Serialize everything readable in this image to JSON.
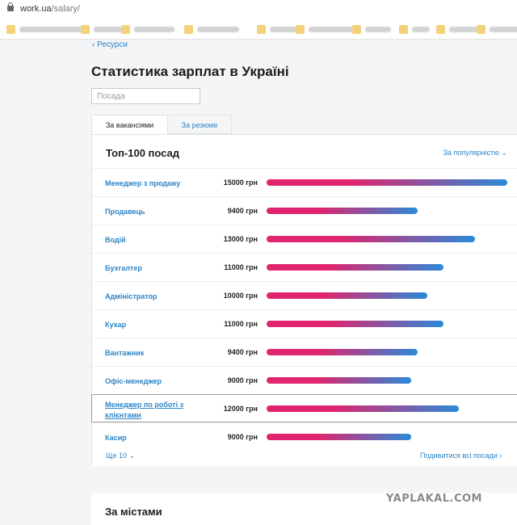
{
  "browser": {
    "url_host": "work.ua",
    "url_path": "/salary/"
  },
  "nav": {
    "back_label": "Ресурси"
  },
  "page": {
    "title": "Статистика зарплат в Україні"
  },
  "search": {
    "placeholder": "Посада",
    "value": ""
  },
  "tabs": [
    {
      "label": "За вакансіями",
      "active": true
    },
    {
      "label": "За резюме",
      "active": false
    }
  ],
  "top": {
    "title": "Топ-100 посад",
    "sort_label": "За популярністю",
    "more_label": "Ще 10",
    "view_all_label": "Подивитися всі посади"
  },
  "chart_data": {
    "type": "bar",
    "orientation": "horizontal",
    "unit": "грн",
    "xlim": [
      0,
      15000
    ],
    "categories": [
      "Менеджер з продажу",
      "Продавець",
      "Водій",
      "Бухгалтер",
      "Адміністратор",
      "Кухар",
      "Вантажник",
      "Офіс-менеджер",
      "Менеджер по роботі з клієнтами",
      "Касир"
    ],
    "values": [
      15000,
      9400,
      13000,
      11000,
      10000,
      11000,
      9400,
      9000,
      12000,
      9000
    ],
    "labels": [
      "15000 грн",
      "9400 грн",
      "13000 грн",
      "11000 грн",
      "10000 грн",
      "11000 грн",
      "9400 грн",
      "9000 грн",
      "12000 грн",
      "9000 грн"
    ],
    "highlighted": "Менеджер по роботі з клієнтами",
    "bar_gradient": [
      "#e0246d",
      "#2b8ad9"
    ]
  },
  "cities": {
    "title": "За містами"
  },
  "watermark": "YAPLAKAL.COM",
  "colors": {
    "link": "#2c84c6",
    "bar_start": "#e0246d",
    "bar_end": "#2b8ad9"
  }
}
